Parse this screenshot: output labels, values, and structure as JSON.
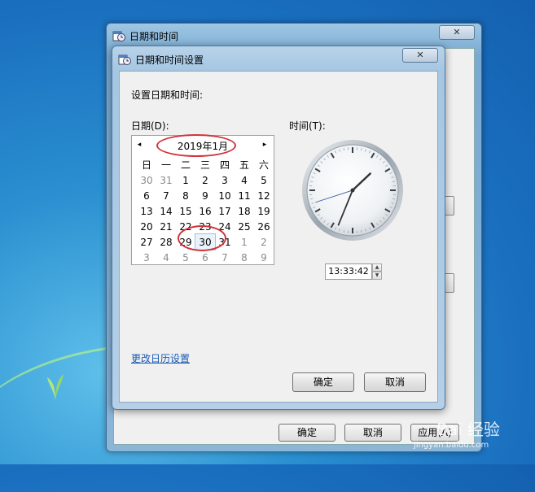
{
  "outer_window": {
    "title": "日期和时间",
    "close_symbol": "✕",
    "buttons": {
      "ok": "确定",
      "cancel": "取消",
      "apply": "应用(A)"
    }
  },
  "dialog": {
    "title": "日期和时间设置",
    "close_symbol": "✕",
    "instruction": "设置日期和时间:",
    "date_label": "日期(D):",
    "time_label": "时间(T):",
    "calendar": {
      "month_title": "2019年1月",
      "prev_symbol": "◂",
      "next_symbol": "▸",
      "weekdays": [
        "日",
        "一",
        "二",
        "三",
        "四",
        "五",
        "六"
      ],
      "weeks": [
        [
          "30",
          "31",
          "1",
          "2",
          "3",
          "4",
          "5"
        ],
        [
          "6",
          "7",
          "8",
          "9",
          "10",
          "11",
          "12"
        ],
        [
          "13",
          "14",
          "15",
          "16",
          "17",
          "18",
          "19"
        ],
        [
          "20",
          "21",
          "22",
          "23",
          "24",
          "25",
          "26"
        ],
        [
          "27",
          "28",
          "29",
          "30",
          "31",
          "1",
          "2"
        ],
        [
          "3",
          "4",
          "5",
          "6",
          "7",
          "8",
          "9"
        ]
      ],
      "selected_day": "30"
    },
    "clock": {
      "hours": 13,
      "minutes": 33,
      "seconds": 42
    },
    "time_value": "13:33:42",
    "spin_up_symbol": "▲",
    "spin_down_symbol": "▼",
    "calendar_settings_link": "更改日历设置",
    "ok_button": "确定",
    "cancel_button": "取消"
  },
  "watermark": {
    "brand": "Bai 经验",
    "url": "jingyan.baidu.com"
  },
  "colors": {
    "accent_link": "#1a5cb4",
    "annotation_red": "#d0333a",
    "title_bar": "#a6c6e2"
  }
}
